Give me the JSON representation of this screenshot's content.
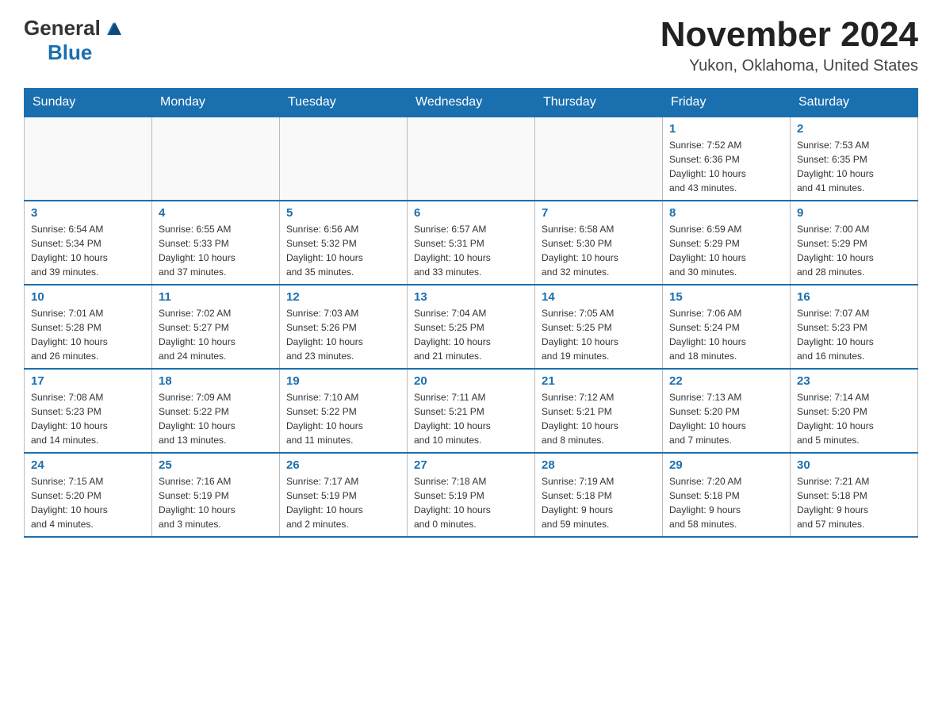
{
  "logo": {
    "general": "General",
    "blue": "Blue"
  },
  "title": "November 2024",
  "subtitle": "Yukon, Oklahoma, United States",
  "headers": [
    "Sunday",
    "Monday",
    "Tuesday",
    "Wednesday",
    "Thursday",
    "Friday",
    "Saturday"
  ],
  "weeks": [
    [
      {
        "day": "",
        "info": ""
      },
      {
        "day": "",
        "info": ""
      },
      {
        "day": "",
        "info": ""
      },
      {
        "day": "",
        "info": ""
      },
      {
        "day": "",
        "info": ""
      },
      {
        "day": "1",
        "info": "Sunrise: 7:52 AM\nSunset: 6:36 PM\nDaylight: 10 hours\nand 43 minutes."
      },
      {
        "day": "2",
        "info": "Sunrise: 7:53 AM\nSunset: 6:35 PM\nDaylight: 10 hours\nand 41 minutes."
      }
    ],
    [
      {
        "day": "3",
        "info": "Sunrise: 6:54 AM\nSunset: 5:34 PM\nDaylight: 10 hours\nand 39 minutes."
      },
      {
        "day": "4",
        "info": "Sunrise: 6:55 AM\nSunset: 5:33 PM\nDaylight: 10 hours\nand 37 minutes."
      },
      {
        "day": "5",
        "info": "Sunrise: 6:56 AM\nSunset: 5:32 PM\nDaylight: 10 hours\nand 35 minutes."
      },
      {
        "day": "6",
        "info": "Sunrise: 6:57 AM\nSunset: 5:31 PM\nDaylight: 10 hours\nand 33 minutes."
      },
      {
        "day": "7",
        "info": "Sunrise: 6:58 AM\nSunset: 5:30 PM\nDaylight: 10 hours\nand 32 minutes."
      },
      {
        "day": "8",
        "info": "Sunrise: 6:59 AM\nSunset: 5:29 PM\nDaylight: 10 hours\nand 30 minutes."
      },
      {
        "day": "9",
        "info": "Sunrise: 7:00 AM\nSunset: 5:29 PM\nDaylight: 10 hours\nand 28 minutes."
      }
    ],
    [
      {
        "day": "10",
        "info": "Sunrise: 7:01 AM\nSunset: 5:28 PM\nDaylight: 10 hours\nand 26 minutes."
      },
      {
        "day": "11",
        "info": "Sunrise: 7:02 AM\nSunset: 5:27 PM\nDaylight: 10 hours\nand 24 minutes."
      },
      {
        "day": "12",
        "info": "Sunrise: 7:03 AM\nSunset: 5:26 PM\nDaylight: 10 hours\nand 23 minutes."
      },
      {
        "day": "13",
        "info": "Sunrise: 7:04 AM\nSunset: 5:25 PM\nDaylight: 10 hours\nand 21 minutes."
      },
      {
        "day": "14",
        "info": "Sunrise: 7:05 AM\nSunset: 5:25 PM\nDaylight: 10 hours\nand 19 minutes."
      },
      {
        "day": "15",
        "info": "Sunrise: 7:06 AM\nSunset: 5:24 PM\nDaylight: 10 hours\nand 18 minutes."
      },
      {
        "day": "16",
        "info": "Sunrise: 7:07 AM\nSunset: 5:23 PM\nDaylight: 10 hours\nand 16 minutes."
      }
    ],
    [
      {
        "day": "17",
        "info": "Sunrise: 7:08 AM\nSunset: 5:23 PM\nDaylight: 10 hours\nand 14 minutes."
      },
      {
        "day": "18",
        "info": "Sunrise: 7:09 AM\nSunset: 5:22 PM\nDaylight: 10 hours\nand 13 minutes."
      },
      {
        "day": "19",
        "info": "Sunrise: 7:10 AM\nSunset: 5:22 PM\nDaylight: 10 hours\nand 11 minutes."
      },
      {
        "day": "20",
        "info": "Sunrise: 7:11 AM\nSunset: 5:21 PM\nDaylight: 10 hours\nand 10 minutes."
      },
      {
        "day": "21",
        "info": "Sunrise: 7:12 AM\nSunset: 5:21 PM\nDaylight: 10 hours\nand 8 minutes."
      },
      {
        "day": "22",
        "info": "Sunrise: 7:13 AM\nSunset: 5:20 PM\nDaylight: 10 hours\nand 7 minutes."
      },
      {
        "day": "23",
        "info": "Sunrise: 7:14 AM\nSunset: 5:20 PM\nDaylight: 10 hours\nand 5 minutes."
      }
    ],
    [
      {
        "day": "24",
        "info": "Sunrise: 7:15 AM\nSunset: 5:20 PM\nDaylight: 10 hours\nand 4 minutes."
      },
      {
        "day": "25",
        "info": "Sunrise: 7:16 AM\nSunset: 5:19 PM\nDaylight: 10 hours\nand 3 minutes."
      },
      {
        "day": "26",
        "info": "Sunrise: 7:17 AM\nSunset: 5:19 PM\nDaylight: 10 hours\nand 2 minutes."
      },
      {
        "day": "27",
        "info": "Sunrise: 7:18 AM\nSunset: 5:19 PM\nDaylight: 10 hours\nand 0 minutes."
      },
      {
        "day": "28",
        "info": "Sunrise: 7:19 AM\nSunset: 5:18 PM\nDaylight: 9 hours\nand 59 minutes."
      },
      {
        "day": "29",
        "info": "Sunrise: 7:20 AM\nSunset: 5:18 PM\nDaylight: 9 hours\nand 58 minutes."
      },
      {
        "day": "30",
        "info": "Sunrise: 7:21 AM\nSunset: 5:18 PM\nDaylight: 9 hours\nand 57 minutes."
      }
    ]
  ]
}
